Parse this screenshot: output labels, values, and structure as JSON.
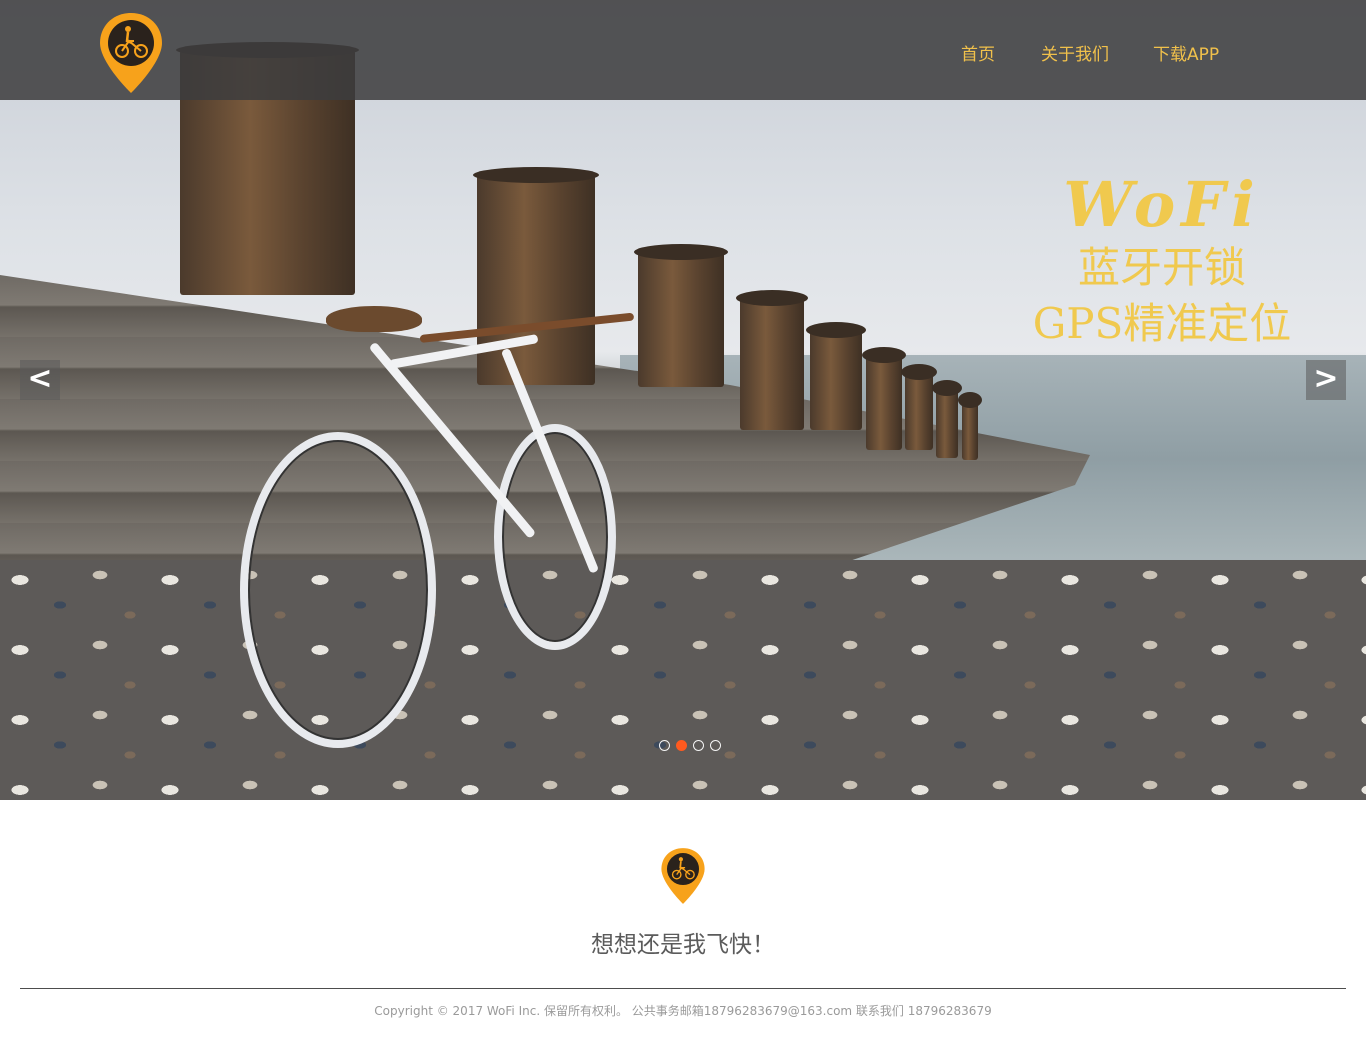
{
  "nav": {
    "items": [
      {
        "label": "首页"
      },
      {
        "label": "关于我们"
      },
      {
        "label": "下载APP"
      }
    ]
  },
  "hero": {
    "brand": "WoFi",
    "line1": "蓝牙开锁",
    "line2": "GPS精准定位",
    "prev_label": "<",
    "next_label": ">",
    "slide_count": 4,
    "active_slide": 2
  },
  "tagline": "想想还是我飞快！",
  "footer": {
    "copyright": "Copyright © 2017 WoFi Inc. 保留所有权利。 公共事务邮箱18796283679@163.com 联系我们 18796283679"
  },
  "colors": {
    "accent": "#f1c14b",
    "logo_orange": "#f7a21b",
    "active_dot": "#ff5a1f",
    "navbar_bg": "#3c3c3e"
  }
}
